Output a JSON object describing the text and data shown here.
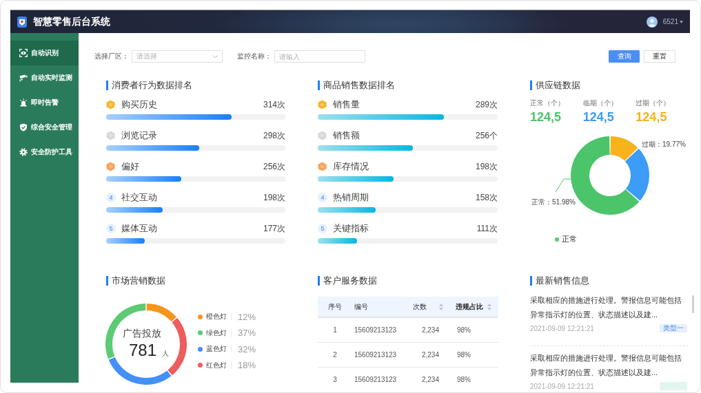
{
  "header": {
    "title": "智慧零售后台系统",
    "user": "6521"
  },
  "sidebar": {
    "items": [
      {
        "label": "自动识别",
        "selected": true
      },
      {
        "label": "自动实时监测",
        "selected": false
      },
      {
        "label": "即时告警",
        "selected": false
      },
      {
        "label": "综合安全管理",
        "selected": false
      },
      {
        "label": "安全防护工具",
        "selected": false
      }
    ]
  },
  "filters": [
    {
      "kind": "select",
      "label": "选择厂区：",
      "placeholder": "请选择"
    },
    {
      "kind": "input",
      "label": "监控名称：",
      "placeholder": "请输入"
    }
  ],
  "buttons": [
    {
      "kind": "primary",
      "label": "查询"
    },
    {
      "kind": "default",
      "label": "重置"
    }
  ],
  "consumer_ranking": {
    "title": "消费者行为数据排名",
    "items": [
      {
        "badge": {
          "kind": "medal",
          "color": "#f7b52c"
        },
        "label": "购买历史",
        "value": "314次",
        "level": 0.7
      },
      {
        "badge": {
          "kind": "medal",
          "color": "#d9d9d9"
        },
        "label": "浏览记录",
        "value": "298次",
        "level": 0.52
      },
      {
        "badge": {
          "kind": "medal",
          "color": "#f6a35c"
        },
        "label": "偏好",
        "value": "256次",
        "level": 0.42
      },
      {
        "badge": {
          "kind": "number",
          "text": "4"
        },
        "label": "社交互动",
        "value": "198次",
        "level": 0.315
      },
      {
        "badge": {
          "kind": "number",
          "text": "5"
        },
        "label": "媒体互动",
        "value": "177次",
        "level": 0.215
      }
    ]
  },
  "product_ranking": {
    "title": "商品销售数据排名",
    "items": [
      {
        "badge": {
          "kind": "medal",
          "color": "#f7b52c"
        },
        "label": "销售量",
        "value": "289次",
        "level": 0.7
      },
      {
        "badge": {
          "kind": "medal",
          "color": "#d9d9d9"
        },
        "label": "销售额",
        "value": "256个",
        "level": 0.53
      },
      {
        "badge": {
          "kind": "medal",
          "color": "#f6a35c"
        },
        "label": "库存情况",
        "value": "198次",
        "level": 0.42
      },
      {
        "badge": {
          "kind": "number",
          "text": "4"
        },
        "label": "热销周期",
        "value": "158次",
        "level": 0.32
      },
      {
        "badge": {
          "kind": "number",
          "text": "5"
        },
        "label": "关键指标",
        "value": "111次",
        "level": 0.22
      }
    ]
  },
  "supply_chain": {
    "title": "供应链数据",
    "stats": [
      {
        "label": "正常（个）",
        "value": "124,5",
        "color": "#4cc46a"
      },
      {
        "label": "临期（个）",
        "value": "124,5",
        "color": "#3d9cf5"
      },
      {
        "label": "过期（个）",
        "value": "124,5",
        "color": "#f8b21d"
      }
    ],
    "donut_labels": [
      "过期：19.77%",
      "正常：51.98%"
    ],
    "legend": [
      {
        "label": "正常",
        "color": "#55c971"
      }
    ]
  },
  "marketing": {
    "title": "市场营销数据",
    "center": {
      "label": "广告投放",
      "value": "781",
      "unit": "人"
    },
    "legend": [
      {
        "label": "橙色灯",
        "percent": "12%",
        "color": "#f7941d"
      },
      {
        "label": "绿色灯",
        "percent": "37%",
        "color": "#5ccb73"
      },
      {
        "label": "蓝色灯",
        "percent": "32%",
        "color": "#4390f7"
      },
      {
        "label": "红色灯",
        "percent": "18%",
        "color": "#ec5d5d"
      }
    ]
  },
  "customer_service": {
    "title": "客户服务数据",
    "columns": [
      {
        "label": "序号",
        "sortable": false,
        "selected": false
      },
      {
        "label": "编号",
        "sortable": false,
        "selected": false
      },
      {
        "label": "次数",
        "sortable": true,
        "selected": false
      },
      {
        "label": "违规占比",
        "sortable": true,
        "selected": true
      }
    ],
    "rows": [
      [
        "1",
        "15609213123",
        "2,234",
        "98%"
      ],
      [
        "2",
        "15609213123",
        "2,234",
        "98%"
      ],
      [
        "3",
        "15609213123",
        "2,234",
        "98%"
      ]
    ]
  },
  "latest_sales": {
    "title": "最新销售信息",
    "items": [
      {
        "text": "采取相应的措施进行处理。警报信息可能包括异常指示灯的位置、状态描述以及建...",
        "time": "2021-09-09 12:21:21",
        "tag": {
          "label": "类型一",
          "color": "#e6f0ff"
        }
      },
      {
        "text": "采取相应的措施进行处理。警报信息可能包括异常指示灯的位置、状态描述以及建...",
        "time": "2021-09-09 12:21:21",
        "tag": {
          "color": "#e2f5ef"
        }
      }
    ]
  }
}
